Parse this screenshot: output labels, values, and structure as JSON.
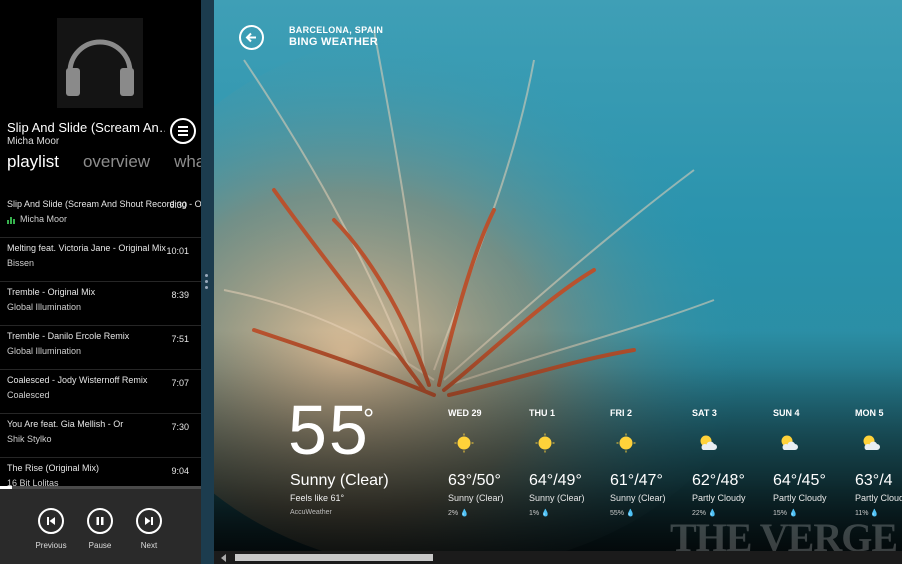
{
  "music": {
    "now_playing": {
      "title": "Slip And Slide (Scream An…",
      "artist": "Micha Moor"
    },
    "tabs": [
      {
        "label": "playlist",
        "active": true
      },
      {
        "label": "overview",
        "active": false
      },
      {
        "label": "wha",
        "active": false
      }
    ],
    "playlist": [
      {
        "title": "Slip And Slide (Scream And Shout Recording - O",
        "duration": "6:30",
        "artist": "Micha Moor",
        "playing": true
      },
      {
        "title": "Melting feat. Victoria Jane - Original Mix",
        "duration": "10:01",
        "artist": "Bissen",
        "playing": false
      },
      {
        "title": "Tremble - Original Mix",
        "duration": "8:39",
        "artist": "Global Illumination",
        "playing": false
      },
      {
        "title": "Tremble - Danilo Ercole Remix",
        "duration": "7:51",
        "artist": "Global Illumination",
        "playing": false
      },
      {
        "title": "Coalesced - Jody Wisternoff Remix",
        "duration": "7:07",
        "artist": "Coalesced",
        "playing": false
      },
      {
        "title": "You Are feat. Gia Mellish - Or",
        "duration": "7:30",
        "artist": "Shik Stylko",
        "playing": false
      },
      {
        "title": "The Rise (Original Mix)",
        "duration": "9:04",
        "artist": "16 Bit Lolitas",
        "playing": false
      }
    ],
    "progress_fraction": 0.06,
    "controls": {
      "previous_label": "Previous",
      "pause_label": "Pause",
      "next_label": "Next"
    }
  },
  "weather": {
    "location": "BARCELONA, SPAIN",
    "app_name": "BING WEATHER",
    "current": {
      "temperature": "55",
      "degree": "°",
      "condition": "Sunny (Clear)",
      "feels_like": "Feels like 61°",
      "provider": "AccuWeather"
    },
    "forecast": [
      {
        "day": "WED 29",
        "temps": "63°/50°",
        "condition": "Sunny (Clear)",
        "precip": "2% 💧",
        "icon": "sun-icon"
      },
      {
        "day": "THU 1",
        "temps": "64°/49°",
        "condition": "Sunny (Clear)",
        "precip": "1% 💧",
        "icon": "sun-icon"
      },
      {
        "day": "FRI 2",
        "temps": "61°/47°",
        "condition": "Sunny (Clear)",
        "precip": "55% 💧",
        "icon": "sun-icon"
      },
      {
        "day": "SAT 3",
        "temps": "62°/48°",
        "condition": "Partly Cloudy",
        "precip": "22% 💧",
        "icon": "partly-cloudy-icon"
      },
      {
        "day": "SUN 4",
        "temps": "64°/45°",
        "condition": "Partly Cloudy",
        "precip": "15% 💧",
        "icon": "partly-cloudy-icon"
      },
      {
        "day": "MON 5",
        "temps": "63°/4",
        "condition": "Partly Cloud",
        "precip": "11% 💧",
        "icon": "partly-cloudy-icon"
      }
    ],
    "scroll_fraction": 0.0
  },
  "watermark": "THE VERGE",
  "colors": {
    "now_playing_indicator": "#37b24d",
    "sun": "#ffd23a",
    "splitter": "#1c3c4e"
  }
}
